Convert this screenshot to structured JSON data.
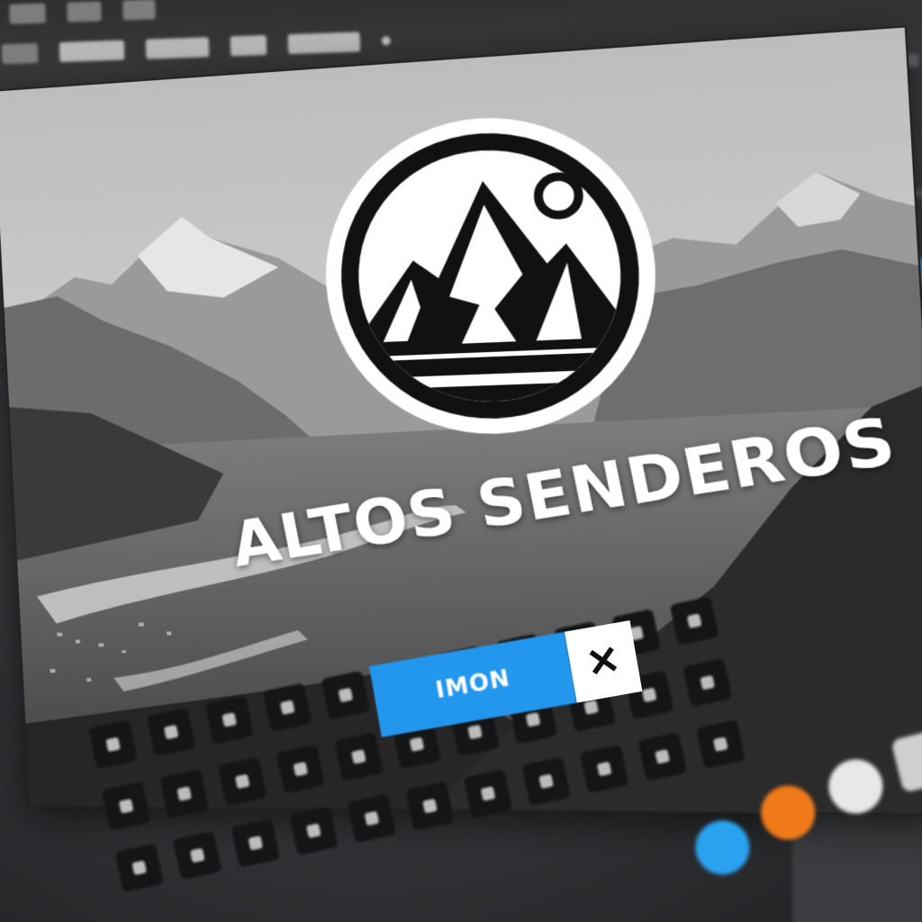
{
  "canvas": {
    "brand_name": "ALTOS SENDEROS",
    "logo": "mountain-sun-emblem"
  },
  "name_field": {
    "value": "IMON",
    "close_label": "✕"
  },
  "colors": {
    "accent": "#2396ee",
    "background": "#333437",
    "logo_black": "#111111",
    "logo_white": "#ffffff",
    "dock_orange": "#f07a1a",
    "dock_blue": "#2aa2f0"
  },
  "icons": {
    "close": "close-icon",
    "logo": "mountain-logo-icon"
  }
}
